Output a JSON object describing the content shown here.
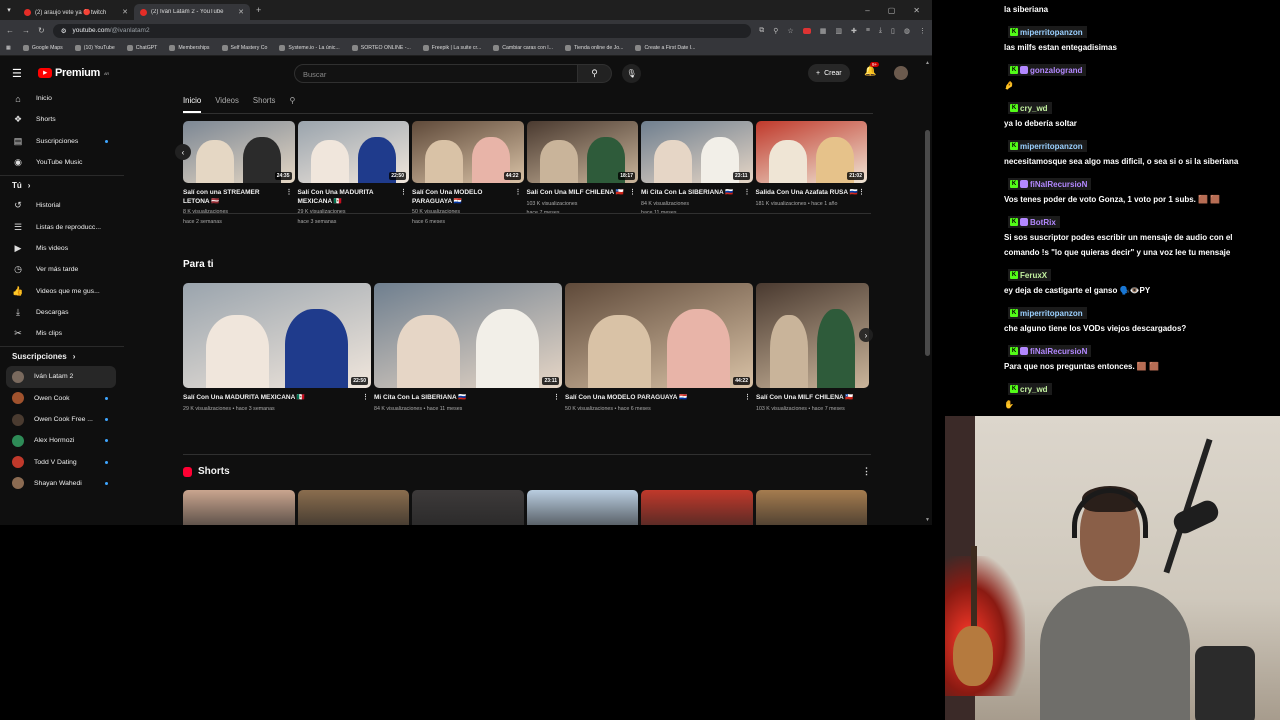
{
  "browser": {
    "tabs": [
      {
        "title": "(2) araujo vete ya 🔴twitch"
      },
      {
        "title": "(2) Iván Latam 2 - YouTube"
      }
    ],
    "url_host": "youtube.com",
    "url_path": "/@ivanlatam2",
    "bookmarks": [
      "Google Maps",
      "(10) YouTube",
      "ChatGPT",
      "Memberships",
      "Self Mastery Co",
      "Systeme.io - La únic...",
      "SORTEO ONLINE -...",
      "Freepik | La suite cr...",
      "Cambiar caras con I...",
      "Tienda online de Jo...",
      "Create a First Date I..."
    ]
  },
  "youtube": {
    "logo_text": "Premium",
    "logo_region": "AR",
    "search_placeholder": "Buscar",
    "create_label": "Crear",
    "notif_count": "9+",
    "sidebar": {
      "items": [
        {
          "label": "Inicio",
          "icon": "home-icon",
          "glyph": "⌂"
        },
        {
          "label": "Shorts",
          "icon": "shorts-icon",
          "glyph": "❖"
        },
        {
          "label": "Suscripciones",
          "icon": "subscriptions-icon",
          "glyph": "▤"
        },
        {
          "label": "YouTube Music",
          "icon": "music-icon",
          "glyph": "◉"
        }
      ],
      "you_header": "Tú",
      "you_items": [
        {
          "label": "Historial",
          "icon": "history-icon",
          "glyph": "↺"
        },
        {
          "label": "Listas de reproducc...",
          "icon": "playlists-icon",
          "glyph": "☰"
        },
        {
          "label": "Mis videos",
          "icon": "my-videos-icon",
          "glyph": "▶"
        },
        {
          "label": "Ver más tarde",
          "icon": "watch-later-icon",
          "glyph": "◷"
        },
        {
          "label": "Videos que me gus...",
          "icon": "liked-icon",
          "glyph": "👍"
        },
        {
          "label": "Descargas",
          "icon": "downloads-icon",
          "glyph": "⤓"
        },
        {
          "label": "Mis clips",
          "icon": "clips-icon",
          "glyph": "✂"
        }
      ],
      "subs_header": "Suscripciones",
      "subs": [
        {
          "label": "Iván Latam 2",
          "color": "#7a6a5e"
        },
        {
          "label": "Owen Cook",
          "color": "#a0522d"
        },
        {
          "label": "Owen Cook Free ...",
          "color": "#4a3b30"
        },
        {
          "label": "Alex Hormozi",
          "color": "#2e8b57"
        },
        {
          "label": "Todd V Dating",
          "color": "#c0392b"
        },
        {
          "label": "Shayan Wahedi",
          "color": "#8b6b52"
        }
      ]
    },
    "channel_tabs": [
      "Inicio",
      "Videos",
      "Shorts"
    ],
    "row1": [
      {
        "title": "Salí con una STREAMER LETONA 🇱🇻",
        "views": "8 K visualizaciones",
        "age": "hace 2 semanas",
        "duration": "24:35"
      },
      {
        "title": "Salí Con Una MADURITA MEXICANA 🇲🇽",
        "views": "29 K visualizaciones",
        "age": "hace 3 semanas",
        "duration": "22:50"
      },
      {
        "title": "Salí Con Una MODELO PARAGUAYA 🇵🇾",
        "views": "50 K visualizaciones",
        "age": "hace 6 meses",
        "duration": "44:22"
      },
      {
        "title": "Salí Con Una MILF CHILENA 🇨🇱",
        "views": "103 K visualizaciones",
        "age": "hace 7 meses",
        "duration": "18:17"
      },
      {
        "title": "Mi Cita Con La SIBERIANA 🇷🇺",
        "views": "84 K visualizaciones",
        "age": "hace 11 meses",
        "duration": "23:11"
      },
      {
        "title": "Salida Con Una Azafata RUSA 🇷🇺",
        "views": "181 K visualizaciones • hace 1 año",
        "age": "",
        "duration": "21:02"
      }
    ],
    "para_ti": "Para ti",
    "row2": [
      {
        "title": "Salí Con Una MADURITA MEXICANA 🇲🇽",
        "meta": "29 K visualizaciones • hace 3 semanas",
        "duration": "22:50"
      },
      {
        "title": "Mi Cita Con La SIBERIANA 🇷🇺",
        "meta": "84 K visualizaciones • hace 11 meses",
        "duration": "23:11"
      },
      {
        "title": "Salí Con Una MODELO PARAGUAYA 🇵🇾",
        "meta": "50 K visualizaciones • hace 6 meses",
        "duration": "44:22"
      },
      {
        "title": "Salí Con Una MILF CHILENA 🇨🇱",
        "meta": "103 K visualizaciones • hace 7 meses",
        "duration": ""
      }
    ],
    "shorts_title": "Shorts"
  },
  "chat": [
    {
      "type": "text",
      "text": "la siberiana"
    },
    {
      "type": "user",
      "name": "miperritopanzon",
      "color": "#9ad0ff"
    },
    {
      "type": "text",
      "text": "las milfs estan entegadisimas"
    },
    {
      "type": "user",
      "name": "gonzalogrand",
      "color": "#b388ff"
    },
    {
      "type": "text",
      "text": "🤌"
    },
    {
      "type": "user",
      "name": "cry_wd",
      "color": "#c3f0a0"
    },
    {
      "type": "text",
      "text": "ya lo debería soltar"
    },
    {
      "type": "user",
      "name": "miperritopanzon",
      "color": "#9ad0ff"
    },
    {
      "type": "text",
      "text": "necesitamosque sea algo mas dificil, o sea si o si la siberiana"
    },
    {
      "type": "user",
      "name": "fiNalRecursioN",
      "color": "#b388ff"
    },
    {
      "type": "text",
      "text": "Vos tenes poder de voto Gonza, 1 voto por 1 subs. 🟫 🟫"
    },
    {
      "type": "user",
      "name": "BotRix",
      "color": "#b388ff"
    },
    {
      "type": "text",
      "text": "Si sos suscriptor podes escribir un mensaje de audio con el"
    },
    {
      "type": "text",
      "text": "comando !s \"lo que quieras decir\" y una voz lee tu mensaje"
    },
    {
      "type": "user",
      "name": "FeruxX",
      "color": "#c3f0a0"
    },
    {
      "type": "text",
      "text": "ey deja de castigarte el ganso 🗣️👁️PY"
    },
    {
      "type": "user",
      "name": "miperritopanzon",
      "color": "#9ad0ff"
    },
    {
      "type": "text",
      "text": "che alguno tiene los VODs viejos descargados?"
    },
    {
      "type": "user",
      "name": "fiNalRecursioN",
      "color": "#b388ff"
    },
    {
      "type": "text",
      "text": "Para que nos preguntas entonces. 🟫 🟫"
    },
    {
      "type": "user",
      "name": "cry_wd",
      "color": "#c3f0a0"
    },
    {
      "type": "text",
      "text": "✋"
    }
  ]
}
